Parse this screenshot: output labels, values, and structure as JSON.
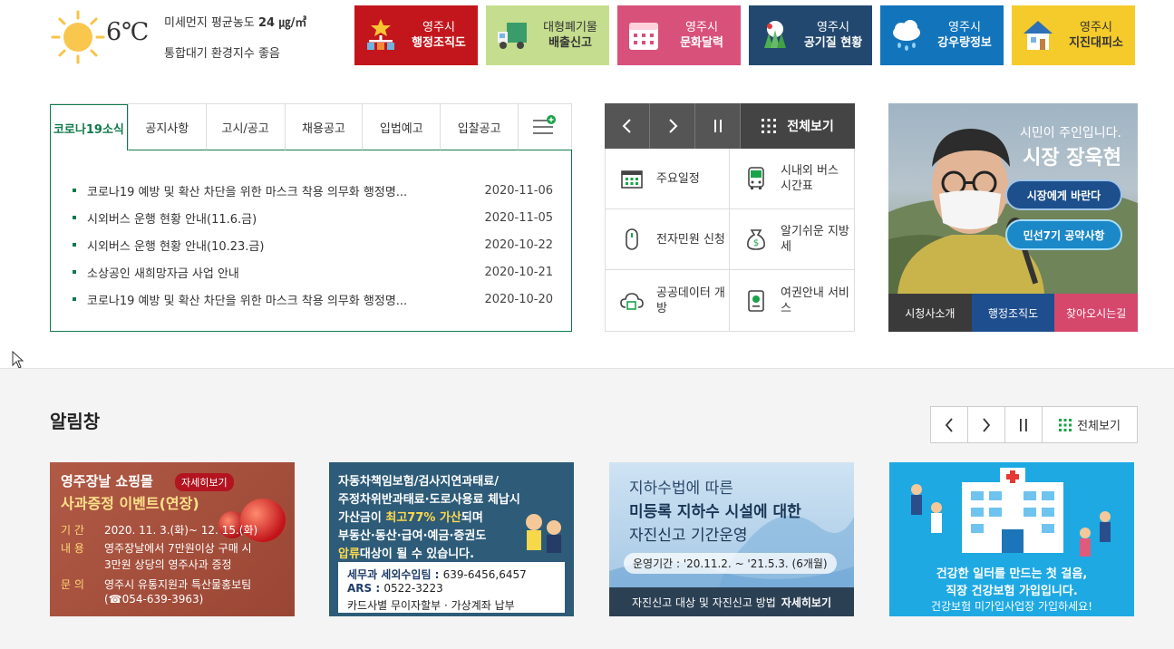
{
  "weather": {
    "temp": "6℃",
    "dust_label": "미세먼지 평균농도",
    "dust_value": "24 ㎍/㎥",
    "air_index": "통합대기 환경지수 좋음"
  },
  "quick_links": [
    {
      "line1": "영주시",
      "line2": "행정조직도",
      "color": "#c3161c",
      "icon": "org-chart-icon"
    },
    {
      "line1": "대형폐기물",
      "line2": "배출신고",
      "color": "#c5dd8e",
      "icon": "truck-icon"
    },
    {
      "line1": "영주시",
      "line2": "문화달력",
      "color": "#d8517a",
      "icon": "calendar-icon"
    },
    {
      "line1": "영주시",
      "line2": "공기질 현황",
      "color": "#22486f",
      "icon": "trees-icon"
    },
    {
      "line1": "영주시",
      "line2": "강우량정보",
      "color": "#1274bb",
      "icon": "rain-cloud-icon"
    },
    {
      "line1": "영주시",
      "line2": "지진대피소",
      "color": "#f4cb2b",
      "icon": "house-icon"
    }
  ],
  "board": {
    "tabs": [
      "코로나19소식",
      "공지사항",
      "고시/공고",
      "채용공고",
      "입법예고",
      "입찰공고"
    ],
    "items": [
      {
        "title": "코로나19 예방 및 확산 차단을 위한 마스크 착용 의무화 행정명...",
        "date": "2020-11-06"
      },
      {
        "title": "시외버스 운행 현황 안내(11.6.금)",
        "date": "2020-11-05"
      },
      {
        "title": "시외버스 운행 현황 안내(10.23.금)",
        "date": "2020-10-22"
      },
      {
        "title": "소상공인 새희망자금 사업 안내",
        "date": "2020-10-21"
      },
      {
        "title": "코로나19 예방 및 확산 차단을 위한 마스크 착용 의무화 행정명...",
        "date": "2020-10-20"
      }
    ]
  },
  "quick_menu": {
    "view_all": "전체보기",
    "items": [
      {
        "label": "주요일정",
        "icon": "schedule-icon"
      },
      {
        "label": "시내외 버스 시간표",
        "icon": "bus-icon"
      },
      {
        "label": "전자민원 신청",
        "icon": "mouse-icon"
      },
      {
        "label": "알기쉬운 지방세",
        "icon": "money-bag-icon"
      },
      {
        "label": "공공데이터 개방",
        "icon": "cloud-data-icon"
      },
      {
        "label": "여권안내 서비스",
        "icon": "passport-icon"
      }
    ]
  },
  "mayor": {
    "slogan": "시민이 주인입니다.",
    "name": "시장 장욱현",
    "btn1": "시장에게 바란다",
    "btn2": "민선7기 공약사항",
    "links": [
      {
        "label": "시청사소개",
        "color": "#3a3a3a"
      },
      {
        "label": "행정조직도",
        "color": "#1f4e8e"
      },
      {
        "label": "찾아오시는길",
        "color": "#d6476c"
      }
    ]
  },
  "notice_board": {
    "title": "알림창",
    "view_all": "전체보기"
  },
  "banners": {
    "b1": {
      "line1": "영주장날 쇼핑몰",
      "badge": "자세히보기",
      "line2": "사과증정 이벤트(연장)",
      "rows": [
        {
          "k": "기  간",
          "v": "2020. 11. 3.(화)~ 12. 15.(화)"
        },
        {
          "k": "내  용",
          "v": "영주장날에서 7만원이상 구매 시"
        },
        {
          "k": "",
          "v": "3만원 상당의 영주사과 증정"
        },
        {
          "k": "문  의",
          "v": "영주시 유통지원과 특산물홍보팀"
        },
        {
          "k": "",
          "v": "(☎054-639-3963)"
        }
      ]
    },
    "b2": {
      "l1": "자동차책임보험/검사지연과태료/",
      "l2": "주정차위반과태료·도로사용료 체납시",
      "l3a": "가산금이 ",
      "l3b": "최고77% 가산",
      "l3c": "되며",
      "l4": "부동산·동산·급여·예금·증권도",
      "l5a": "압류",
      "l5b": "대상이 될 수 있습니다.",
      "r1a": "세무과 세외수입팀 : ",
      "r1b": "639-6456,6457",
      "r2a": "ARS : ",
      "r2b": "0522-3223",
      "r3": "카드사별 무이자할부 · 가상계좌 납부"
    },
    "b3": {
      "t1": "지하수법에 따른",
      "t2": "미등록 지하수 시설에 대한",
      "t3": "자진신고 기간운영",
      "period": "운영기간 : '20.11.2. ~ '21.5.3. (6개월)",
      "bar": "자진신고 대상 및 자진신고 방법",
      "bar_more": "자세히보기"
    },
    "b4": {
      "t1": "건강한 일터를 만드는 첫 걸음,",
      "t2": "직장 건강보험 가입입니다.",
      "t3": "건강보험 미가입사업장 가입하세요!"
    }
  }
}
